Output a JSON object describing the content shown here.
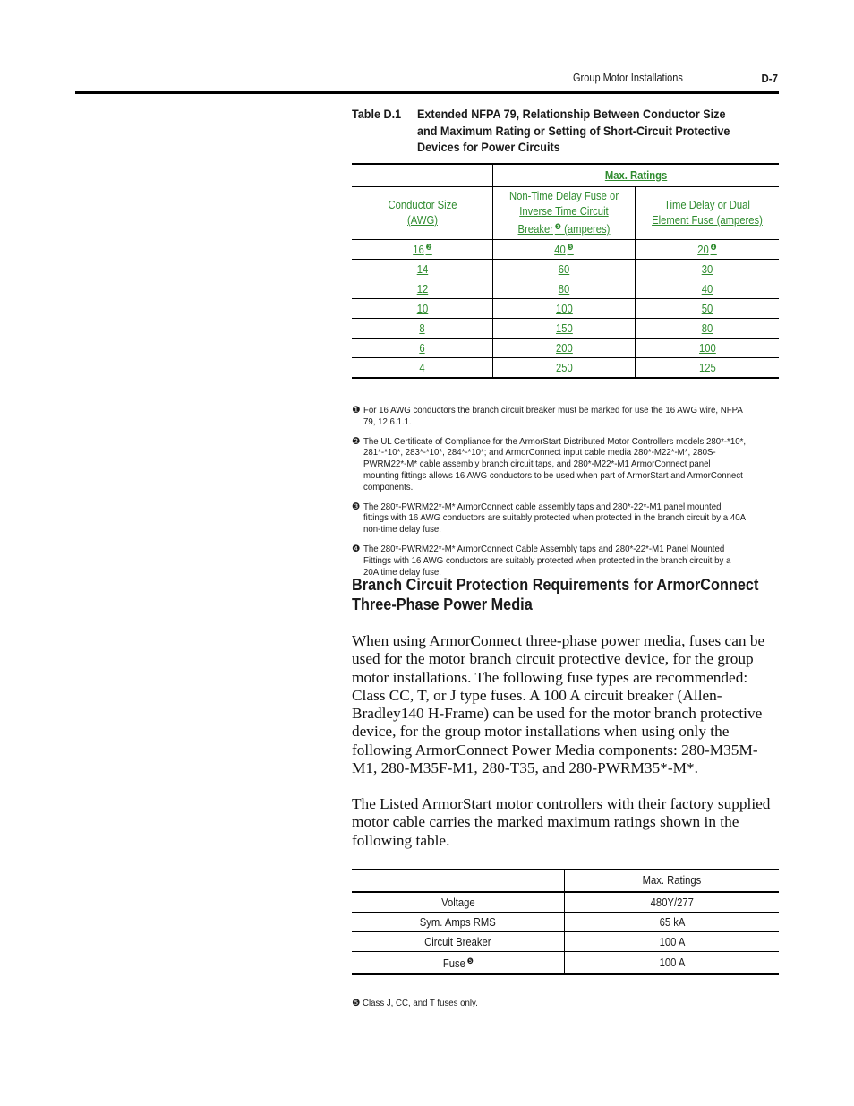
{
  "header": {
    "running_title": "Group Motor Installations",
    "page_number": "D-7"
  },
  "table1": {
    "caption_label": "Table D.1",
    "caption_text": "Extended NFPA 79, Relationship Between Conductor Size and Maximum Rating or Setting of Short-Circuit Protective Devices for Power Circuits",
    "group_header": "Max. Ratings",
    "columns": [
      {
        "label": "Conductor Size (AWG)",
        "note": ""
      },
      {
        "label": "Non-Time Delay Fuse or Inverse Time Circuit Breaker",
        "note": "❶",
        "suffix": "(amperes)"
      },
      {
        "label": "Time Delay or Dual Element Fuse (amperes)",
        "note": ""
      }
    ],
    "rows": [
      {
        "size": "16",
        "size_note": "❷",
        "non_time_delay": "40",
        "ntd_note": "❸",
        "time_delay": "20",
        "td_note": "❹"
      },
      {
        "size": "14",
        "non_time_delay": "60",
        "time_delay": "30"
      },
      {
        "size": "12",
        "non_time_delay": "80",
        "time_delay": "40"
      },
      {
        "size": "10",
        "non_time_delay": "100",
        "time_delay": "50"
      },
      {
        "size": "8",
        "non_time_delay": "150",
        "time_delay": "80"
      },
      {
        "size": "6",
        "non_time_delay": "200",
        "time_delay": "100"
      },
      {
        "size": "4",
        "non_time_delay": "250",
        "time_delay": "125"
      }
    ],
    "link_color": "#2e8b2e"
  },
  "footnotes": [
    {
      "marker": "❶",
      "text": "For 16 AWG conductors the branch circuit breaker must be marked for use the 16 AWG wire, NFPA 79, 12.6.1.1."
    },
    {
      "marker": "❷",
      "text": "The UL Certificate of Compliance for the ArmorStart Distributed Motor Controllers models 280*-*10*, 281*-*10*, 283*-*10*, 284*-*10*; and ArmorConnect input cable media 280*-M22*-M*, 280S-PWRM22*-M* cable assembly branch circuit taps, and 280*-M22*-M1 ArmorConnect panel mounting fittings allows 16 AWG conductors to be used when part of ArmorStart and ArmorConnect components."
    },
    {
      "marker": "❸",
      "text": "The 280*-PWRM22*-M* ArmorConnect cable assembly taps and 280*-22*-M1 panel mounted fittings with 16 AWG conductors are suitably protected when protected in the branch circuit by a 40A non-time delay fuse."
    },
    {
      "marker": "❹",
      "text": "The 280*-PWRM22*-M* ArmorConnect Cable Assembly taps and 280*-22*-M1 Panel Mounted Fittings with 16 AWG conductors are suitably protected when protected in the branch circuit by a 20A time delay fuse."
    }
  ],
  "section": {
    "title": "Branch Circuit Protection Requirements for ArmorConnect Three-Phase Power Media",
    "paragraphs": [
      "When using ArmorConnect three-phase power media, fuses can be used for the motor branch circuit protective device, for the group motor installations. The following fuse types are recommended: Class CC, T, or J type fuses. A 100 A circuit breaker (Allen-Bradley140 H-Frame) can be used for the motor branch protective device, for the group motor installations when using only the following ArmorConnect Power Media components: 280-M35M-M1, 280-M35F-M1, 280-T35, and 280-PWRM35*-M*.",
      "The Listed ArmorStart motor controllers with their factory supplied motor cable carries the marked maximum ratings shown in the following table."
    ]
  },
  "table2": {
    "header": "Max. Ratings",
    "rows": [
      {
        "label": "Voltage",
        "note": "",
        "value": "480Y/277"
      },
      {
        "label": "Sym. Amps RMS",
        "note": "",
        "value": "65 kA"
      },
      {
        "label": "Circuit Breaker",
        "note": "",
        "value": "100 A"
      },
      {
        "label": "Fuse",
        "note": "❺",
        "value": "100 A"
      }
    ]
  },
  "footnote5": {
    "marker": "❺",
    "text": "Class J, CC, and T fuses only."
  }
}
